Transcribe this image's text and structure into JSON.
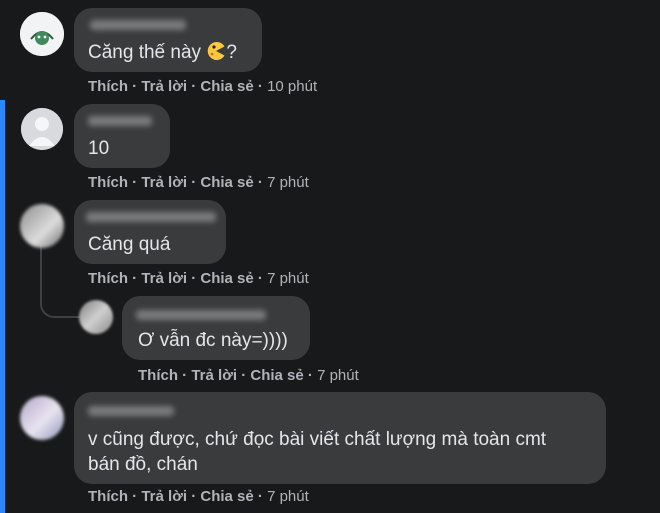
{
  "actions": {
    "like": "Thích",
    "reply": "Trả lời",
    "share": "Chia sẻ",
    "sep": " · "
  },
  "comments": [
    {
      "text": "Căng thế này",
      "suffix": "?",
      "time": "10 phút"
    },
    {
      "text": "10",
      "time": "7 phút"
    },
    {
      "text": "Căng quá",
      "time": "7 phút"
    },
    {
      "text": "Ơ vẫn đc này=))))",
      "time": "7 phút"
    },
    {
      "text_line1": "v cũng được, chứ đọc bài viết chất lượng mà toàn cmt",
      "text_line2": "bán đồ, chán",
      "time": "7 phút"
    }
  ],
  "colors": {
    "background": "#18191a",
    "bubble": "#3a3b3c",
    "highlight_bar": "#2d88ff"
  },
  "icons": [
    "pacman-emoji-icon",
    "avatar-icon"
  ]
}
